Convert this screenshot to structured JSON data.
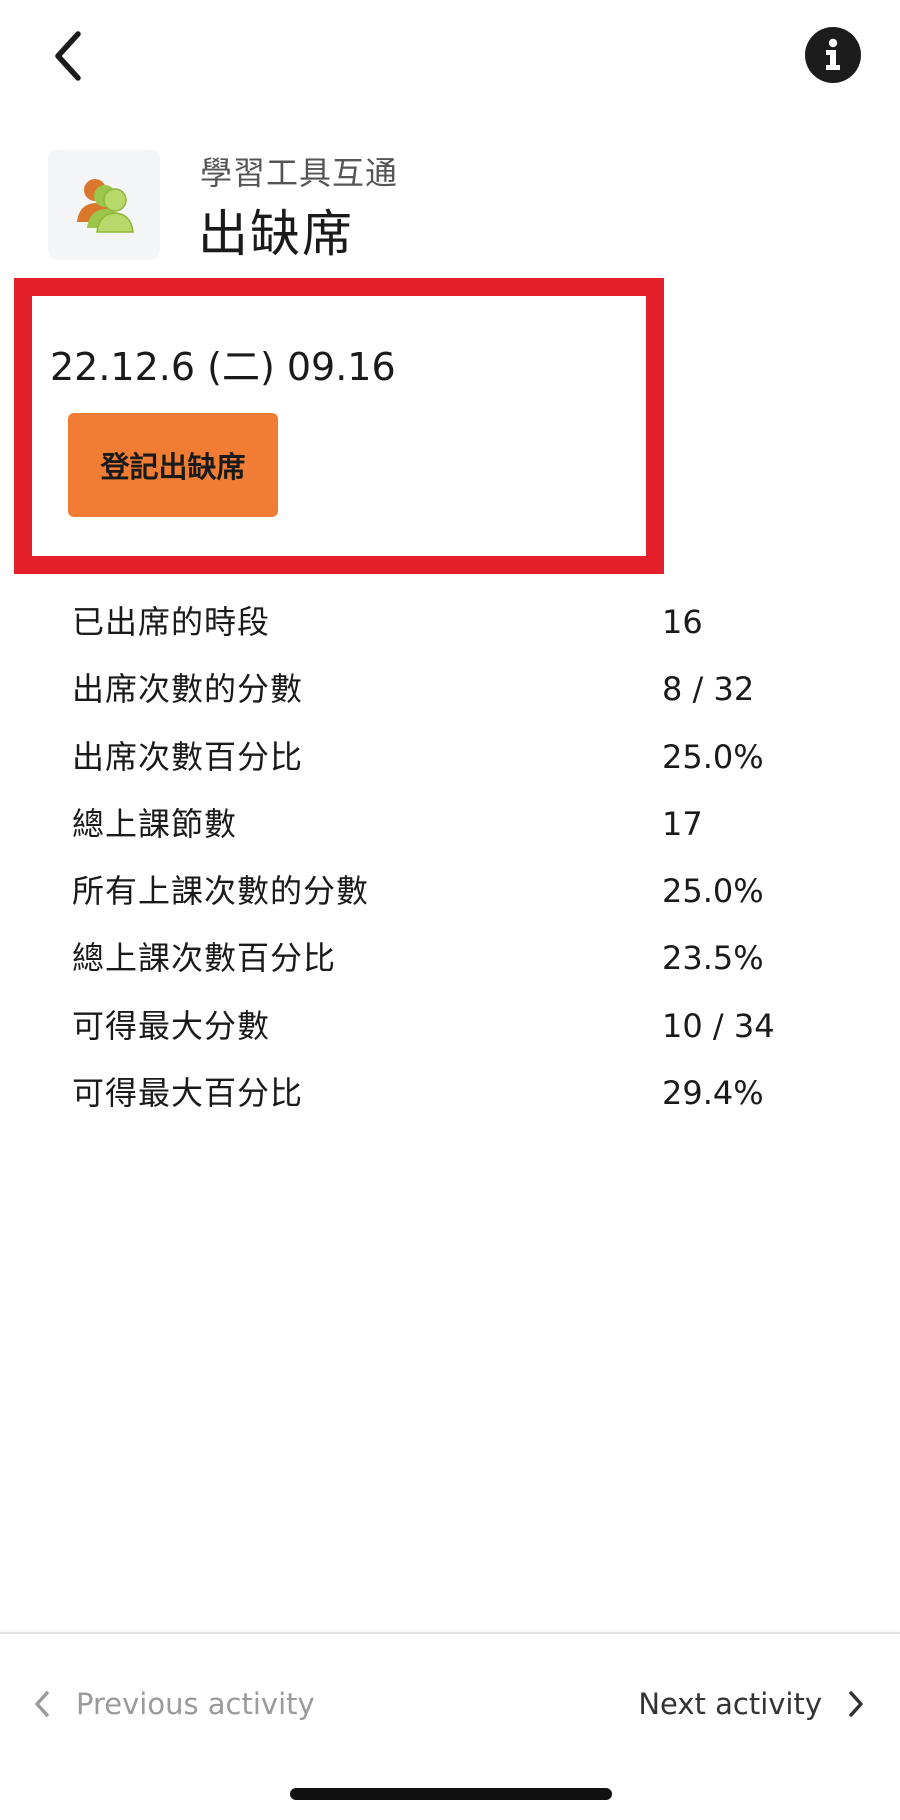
{
  "header": {
    "course_name": "學習工具互通",
    "title": "出缺席"
  },
  "session": {
    "date": "22.12.6 (二) 09.16",
    "record_button_label": "登記出缺席"
  },
  "stats": [
    {
      "label": "已出席的時段",
      "value": "16"
    },
    {
      "label": "出席次數的分數",
      "value": "8 / 32"
    },
    {
      "label": "出席次數百分比",
      "value": "25.0%"
    },
    {
      "label": "總上課節數",
      "value": "17"
    },
    {
      "label": "所有上課次數的分數",
      "value": "25.0%"
    },
    {
      "label": "總上課次數百分比",
      "value": "23.5%"
    },
    {
      "label": "可得最大分數",
      "value": "10 / 34"
    },
    {
      "label": "可得最大百分比",
      "value": "29.4%"
    }
  ],
  "nav": {
    "previous_label": "Previous activity",
    "next_label": "Next activity"
  },
  "icons": {
    "back": "chevron-left-icon",
    "info": "info-icon",
    "activity": "attendance-people-icon"
  },
  "colors": {
    "highlight_border": "#e4202a",
    "button_background": "#f07d33",
    "info_background": "#1c1c1c"
  }
}
